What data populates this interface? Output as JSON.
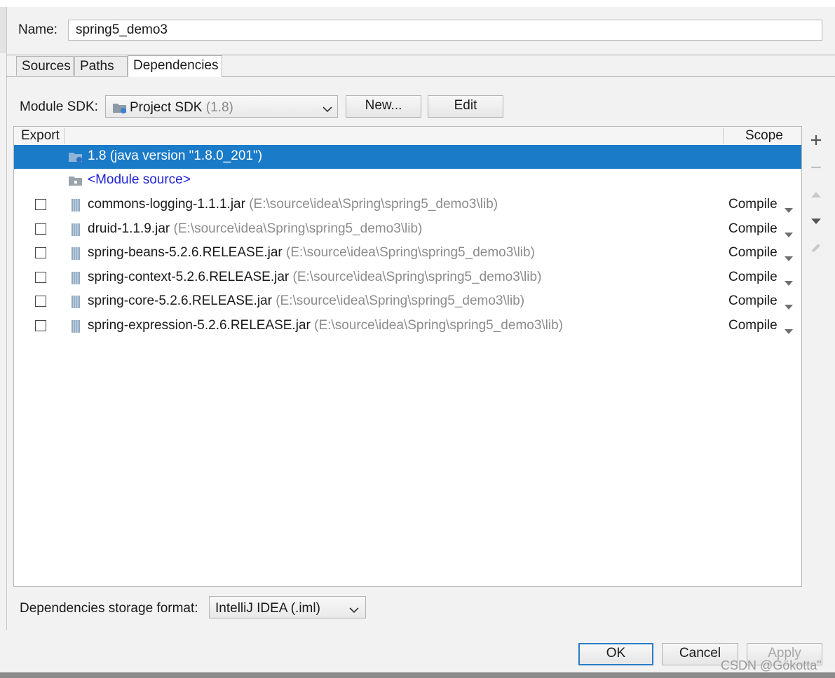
{
  "name_field": {
    "label": "Name:",
    "value": "spring5_demo3"
  },
  "tabs": [
    {
      "label": "Sources",
      "active": false
    },
    {
      "label": "Paths",
      "active": false
    },
    {
      "label": "Dependencies",
      "active": true
    }
  ],
  "module_sdk": {
    "label": "Module SDK:",
    "selected": "Project SDK",
    "version": "(1.8)",
    "new_button": "New...",
    "edit_button": "Edit"
  },
  "table": {
    "header_export": "Export",
    "header_scope": "Scope",
    "sdk_row": {
      "label": "1.8 (java version \"1.8.0_201\")",
      "selected": true
    },
    "module_source_row": {
      "label": "<Module source>"
    },
    "dependencies": [
      {
        "name": "commons-logging-1.1.1.jar",
        "path": "(E:\\source\\idea\\Spring\\spring5_demo3\\lib)",
        "scope": "Compile",
        "exported": false
      },
      {
        "name": "druid-1.1.9.jar",
        "path": "(E:\\source\\idea\\Spring\\spring5_demo3\\lib)",
        "scope": "Compile",
        "exported": false
      },
      {
        "name": "spring-beans-5.2.6.RELEASE.jar",
        "path": "(E:\\source\\idea\\Spring\\spring5_demo3\\lib)",
        "scope": "Compile",
        "exported": false
      },
      {
        "name": "spring-context-5.2.6.RELEASE.jar",
        "path": "(E:\\source\\idea\\Spring\\spring5_demo3\\lib)",
        "scope": "Compile",
        "exported": false
      },
      {
        "name": "spring-core-5.2.6.RELEASE.jar",
        "path": "(E:\\source\\idea\\Spring\\spring5_demo3\\lib)",
        "scope": "Compile",
        "exported": false
      },
      {
        "name": "spring-expression-5.2.6.RELEASE.jar",
        "path": "(E:\\source\\idea\\Spring\\spring5_demo3\\lib)",
        "scope": "Compile",
        "exported": false
      }
    ]
  },
  "side_toolbar": [
    "plus-icon",
    "minus-icon",
    "move-up-icon",
    "move-down-icon",
    "edit-pencil-icon"
  ],
  "storage_format": {
    "label": "Dependencies storage format:",
    "selected": "IntelliJ IDEA (.iml)"
  },
  "buttons": {
    "ok": "OK",
    "cancel": "Cancel",
    "apply": "Apply"
  },
  "watermark": "CSDN @Gökotta\"",
  "colors": {
    "selection": "#1a7bc9",
    "link": "#1f25d6",
    "path_gray": "#8c8c8c"
  }
}
